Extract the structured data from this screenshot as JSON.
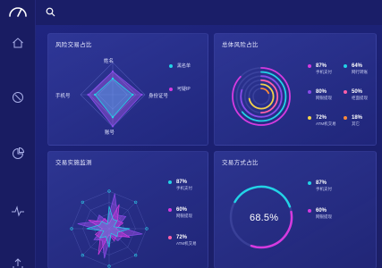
{
  "app": {
    "logo_icon": "speedometer-icon",
    "nav_icons": [
      "home-icon",
      "compass-icon",
      "pie-chart-icon",
      "pulse-icon",
      "upload-icon"
    ],
    "search_icon": "search-icon"
  },
  "colors": {
    "background": "#1b1f6b",
    "cyan": "#22d3e6",
    "magenta": "#d63adf",
    "purple": "#8a4bea",
    "pink": "#ff5fa8",
    "yellow": "#f3d24a",
    "orange": "#ff8a3a"
  },
  "panels": {
    "risk_types": {
      "title": "风险交易占比",
      "axes": [
        "姓名",
        "身份证号",
        "账号",
        "手机号"
      ],
      "legend": [
        "黑名单",
        "可疑IP"
      ]
    },
    "overall_risk": {
      "title": "总体风险占比",
      "items": [
        {
          "value": "87%",
          "label": "手机支付"
        },
        {
          "value": "64%",
          "label": "网行转账"
        },
        {
          "value": "80%",
          "label": "网银提现"
        },
        {
          "value": "50%",
          "label": "柜面提现"
        },
        {
          "value": "72%",
          "label": "ATM机交易"
        },
        {
          "value": "18%",
          "label": "其它"
        }
      ]
    },
    "realtime": {
      "title": "交易实施监测",
      "items": [
        {
          "value": "87%",
          "label": "手机支付"
        },
        {
          "value": "60%",
          "label": "网银提现"
        },
        {
          "value": "72%",
          "label": "ATM机交易"
        }
      ]
    },
    "method": {
      "title": "交易方式占比",
      "center_value": "68.5%",
      "items": [
        {
          "value": "87%",
          "label": "手机支付"
        },
        {
          "value": "60%",
          "label": "网银提现"
        }
      ]
    }
  },
  "chart_data": [
    {
      "type": "radar",
      "title": "风险交易占比",
      "categories": [
        "姓名",
        "身份证号",
        "账号",
        "手机号"
      ],
      "series": [
        {
          "name": "黑名单",
          "values": [
            0.72,
            0.9,
            0.98,
            0.76
          ]
        },
        {
          "name": "可疑IP",
          "values": [
            0.5,
            0.62,
            0.7,
            0.55
          ]
        }
      ]
    },
    {
      "type": "radial-bar",
      "title": "总体风险占比",
      "categories": [
        "手机支付",
        "网行转账",
        "网银提现",
        "柜面提现",
        "ATM机交易",
        "其它"
      ],
      "values": [
        87,
        64,
        80,
        50,
        72,
        18
      ]
    },
    {
      "type": "radar",
      "title": "交易实施监测",
      "categories": [
        "手机支付",
        "网银提现",
        "ATM机交易"
      ],
      "values": [
        87,
        60,
        72
      ]
    },
    {
      "type": "pie",
      "title": "交易方式占比",
      "categories": [
        "手机支付",
        "网银提现"
      ],
      "center": "68.5%"
    }
  ]
}
